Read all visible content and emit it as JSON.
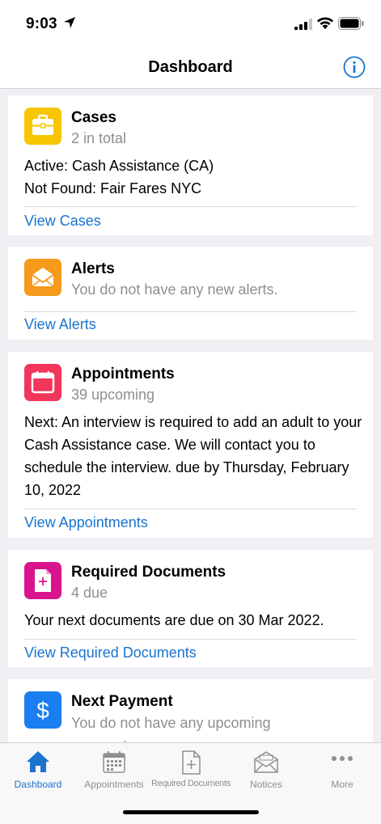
{
  "status_bar": {
    "time": "9:03"
  },
  "nav": {
    "title": "Dashboard"
  },
  "cards": {
    "cases": {
      "title": "Cases",
      "subtitle": "2 in total",
      "lines": [
        "Active: Cash Assistance (CA)",
        "Not Found: Fair Fares NYC"
      ],
      "link": "View Cases",
      "icon": "briefcase-icon",
      "color": "#f7c600"
    },
    "alerts": {
      "title": "Alerts",
      "subtitle": "You do not have any new alerts.",
      "link": "View Alerts",
      "icon": "envelope-icon",
      "color": "#f59a1b"
    },
    "appointments": {
      "title": "Appointments",
      "subtitle": "39 upcoming",
      "body": "Next: An interview is required to add an adult to your Cash Assistance case. We will contact you to schedule the interview. due by Thursday, February 10, 2022",
      "link": "View Appointments",
      "icon": "calendar-icon",
      "color": "#f2355a"
    },
    "documents": {
      "title": "Required Documents",
      "subtitle": "4 due",
      "body": "Your next documents are due on 30 Mar 2022.",
      "link": "View Required Documents",
      "icon": "document-add-icon",
      "color": "#d9148f"
    },
    "payment": {
      "title": "Next Payment",
      "subtitle": "You do not have any upcoming payments.",
      "icon": "dollar-icon",
      "color": "#1a7ef0"
    }
  },
  "tabs": [
    {
      "label": "Dashboard",
      "icon": "home-icon",
      "active": true
    },
    {
      "label": "Appointments",
      "icon": "calendar-icon",
      "active": false
    },
    {
      "label": "Required Documents",
      "icon": "document-add-icon",
      "active": false
    },
    {
      "label": "Notices",
      "icon": "envelope-icon",
      "active": false
    },
    {
      "label": "More",
      "icon": "ellipsis-icon",
      "active": false
    }
  ],
  "colors": {
    "accent": "#1a73cf",
    "secondary_text": "#8e8e93",
    "background": "#efeff4"
  }
}
